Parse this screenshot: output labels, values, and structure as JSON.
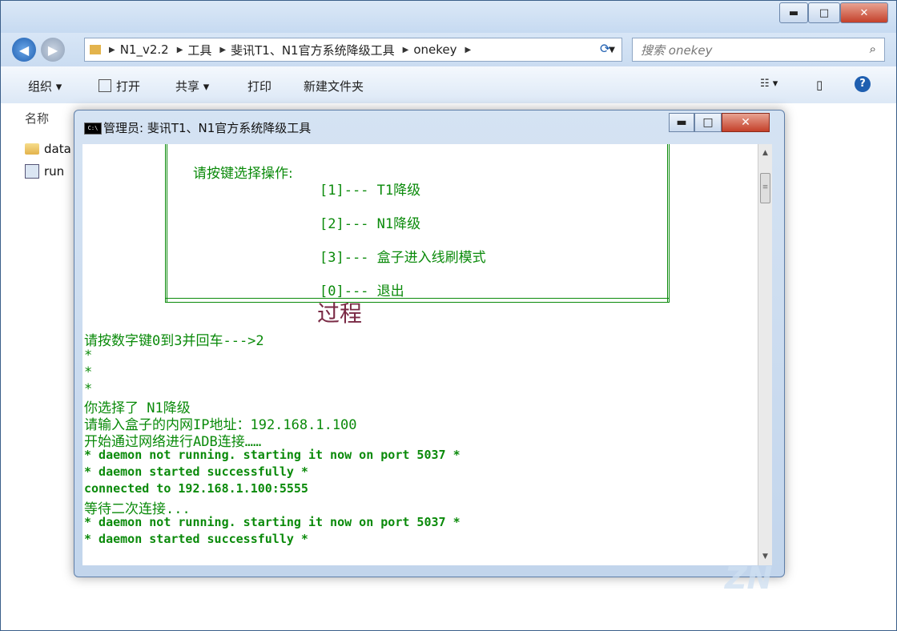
{
  "explorer": {
    "caption_buttons": {
      "minimize": "▬",
      "maximize": "□",
      "close": "✕"
    },
    "address": {
      "segments": [
        "N1_v2.2",
        "工具",
        "斐讯T1、N1官方系统降级工具",
        "onekey"
      ],
      "search_placeholder": "搜索 onekey"
    },
    "toolbar": {
      "organize": "组织 ▾",
      "open": "打开",
      "share": "共享 ▾",
      "print": "打印",
      "new_folder": "新建文件夹"
    },
    "column_name": "名称",
    "files": [
      "data",
      "run"
    ]
  },
  "console": {
    "title": "管理员: 斐讯T1、N1官方系统降级工具",
    "menu": {
      "prompt": "请按键选择操作:",
      "options": [
        "[1]--- T1降级",
        "[2]--- N1降级",
        "[3]--- 盒子进入线刷模式",
        "[0]--- 退出"
      ],
      "bottom_rule": "=========================================================="
    },
    "overlay_label": "过程",
    "lines": [
      "请按数字键0到3并回车--->2",
      "*",
      "*",
      "*",
      "你选择了 N1降级",
      "请输入盒子的内网IP地址：192.168.1.100",
      "开始通过网络进行ADB连接……",
      "* daemon not running. starting it now on port 5037 *",
      "* daemon started successfully *",
      "connected to 192.168.1.100:5555",
      "等待二次连接...",
      "* daemon not running. starting it now on port 5037 *",
      "* daemon started successfully *"
    ]
  },
  "colors": {
    "console_text": "#0a8a0a",
    "overlay_label": "#7a2a45"
  }
}
